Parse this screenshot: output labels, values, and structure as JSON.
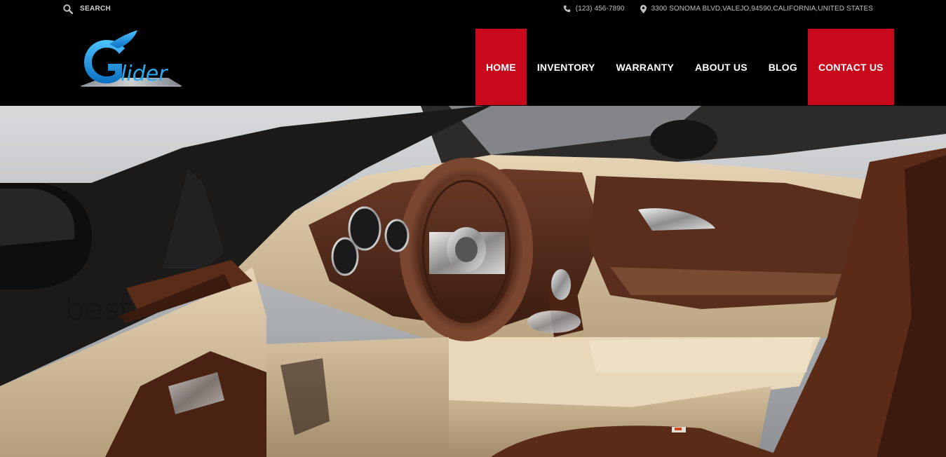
{
  "topbar": {
    "search_label": "SEARCH",
    "phone": "(123) 456-7890",
    "address": "3300 SONOMA BLVD,VALEJO,94590,CALIFORNIA,UNITED STATES"
  },
  "logo": {
    "text": "Glider"
  },
  "nav": {
    "items": [
      {
        "label": "HOME"
      },
      {
        "label": "INVENTORY"
      },
      {
        "label": "WARRANTY"
      },
      {
        "label": "ABOUT US"
      },
      {
        "label": "BLOG"
      },
      {
        "label": "CONTACT US"
      }
    ]
  },
  "hero": {
    "watermark": "best"
  },
  "colors": {
    "accent": "#c8091c",
    "logo_blue": "#1fa3e6",
    "background": "#000000"
  }
}
